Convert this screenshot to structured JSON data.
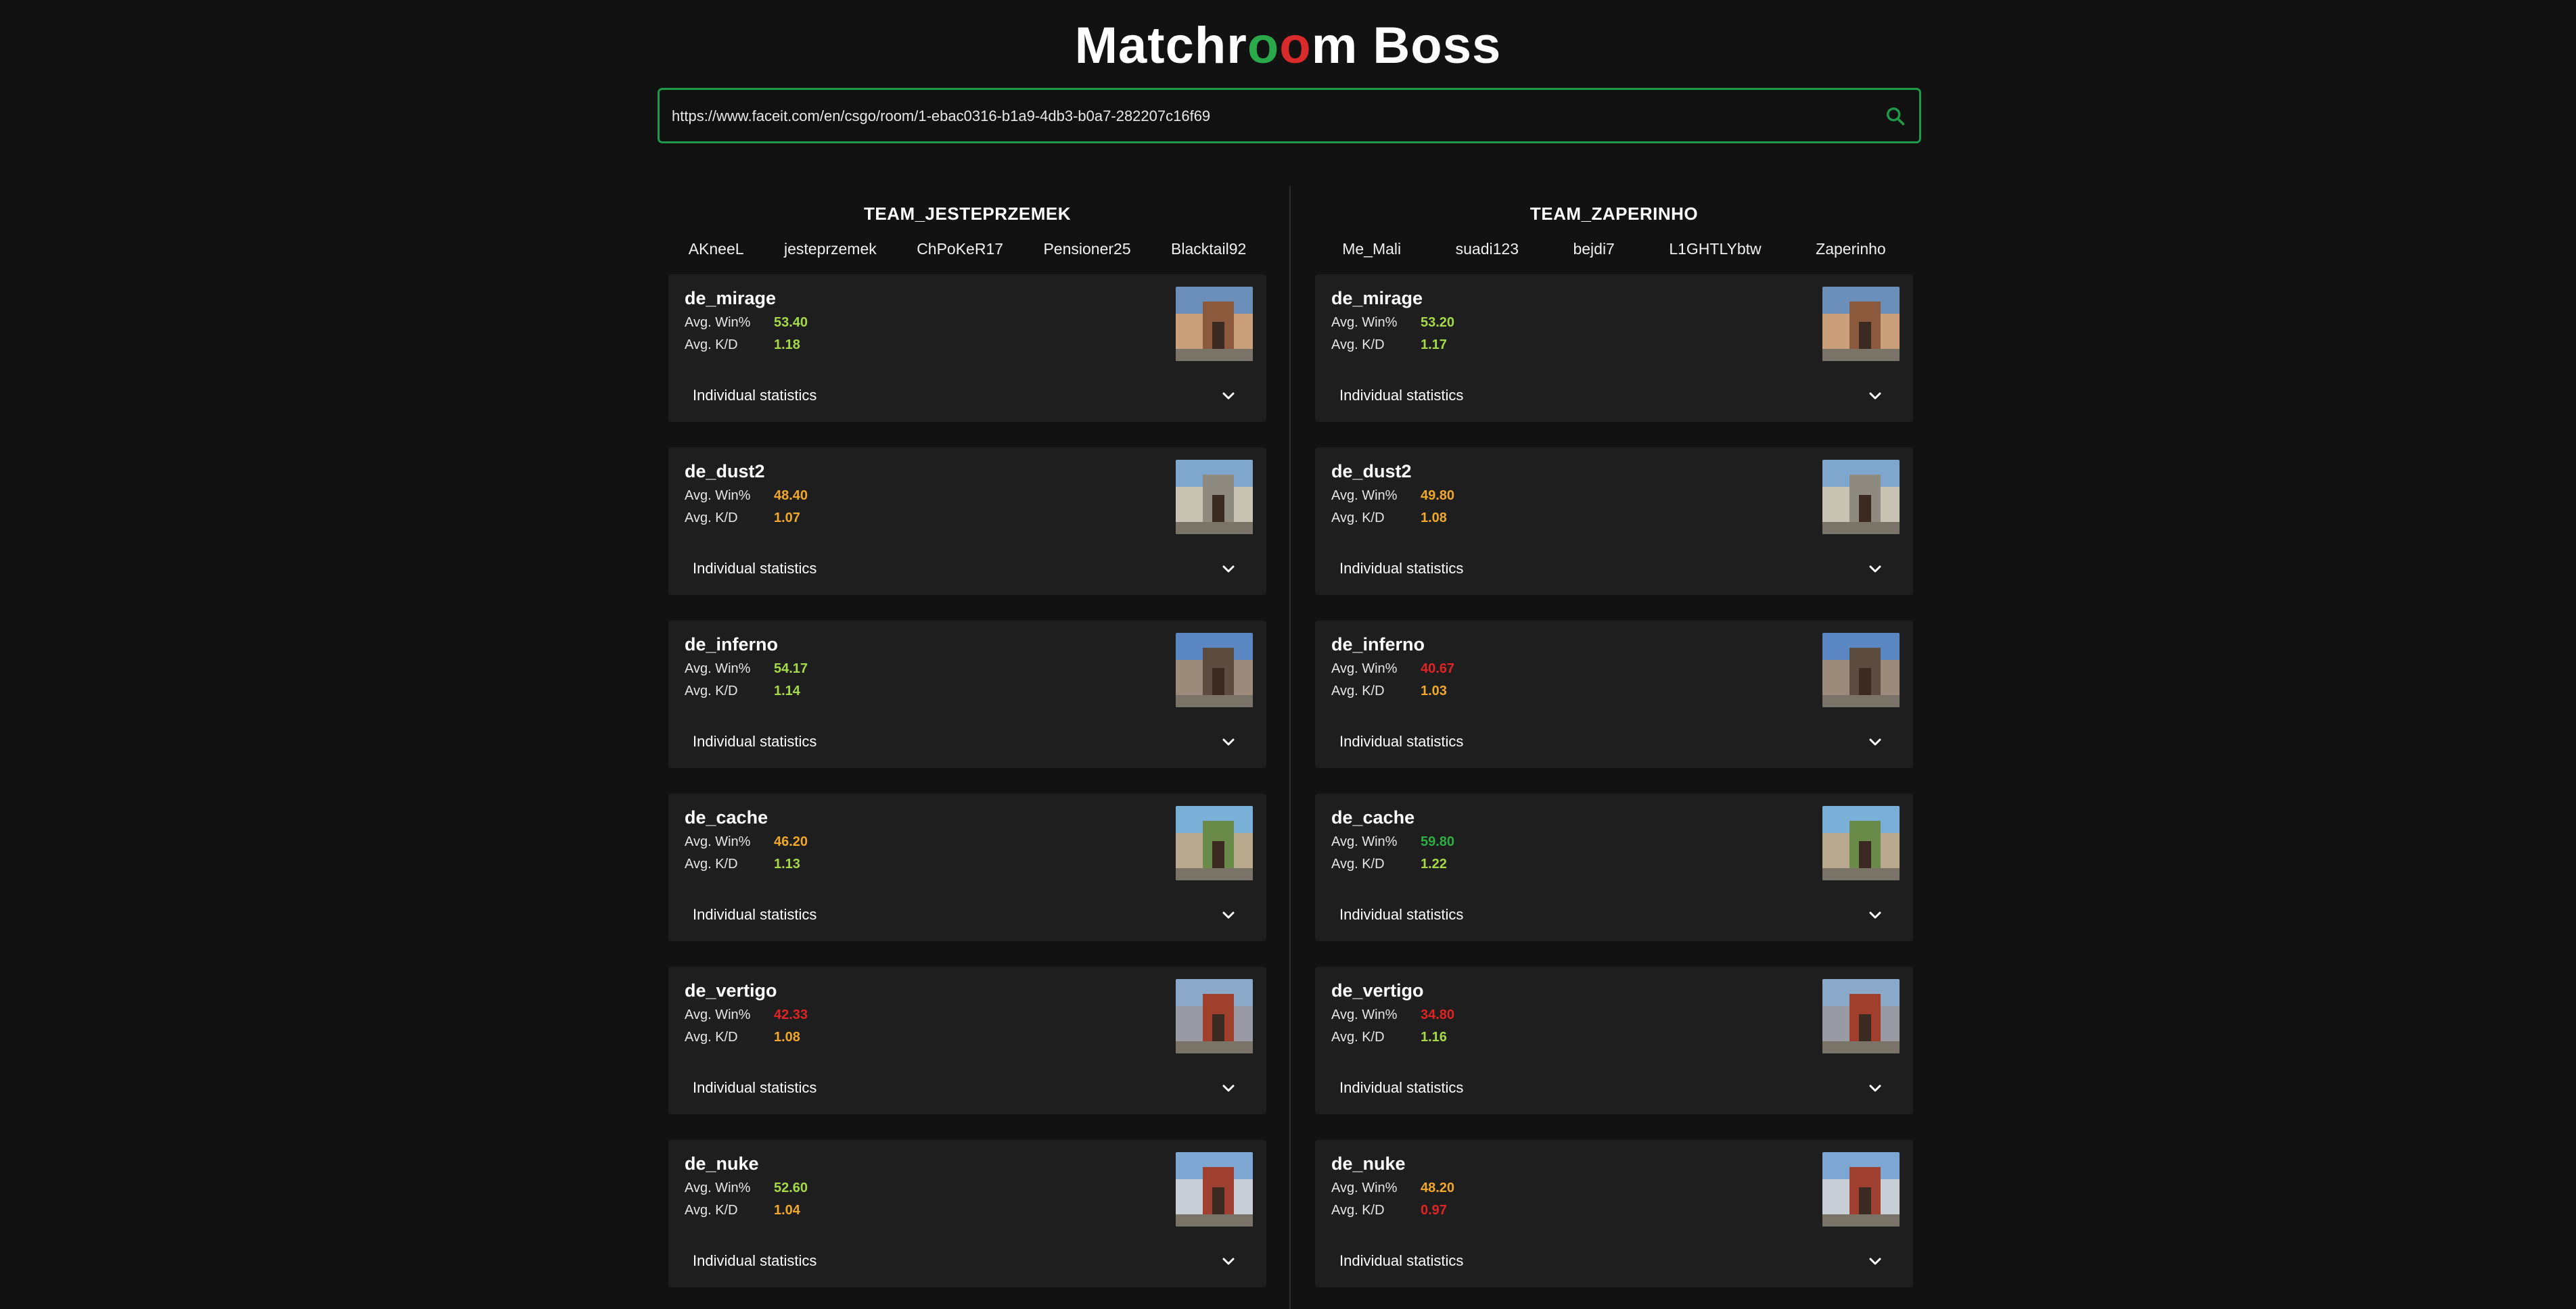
{
  "app": {
    "title_parts": [
      "Matchr",
      "o",
      "o",
      "m Boss"
    ]
  },
  "search": {
    "value": "https://www.faceit.com/en/csgo/room/1-ebac0316-b1a9-4db3-b0a7-282207c16f69",
    "icon": "search-icon"
  },
  "colors": {
    "accent_green": "#1e9a4a",
    "stat_good": "#a6d94a",
    "stat_mid": "#f0a72a",
    "stat_bad": "#e02424",
    "stat_great": "#2fae44"
  },
  "teams": [
    {
      "name": "TEAM_JESTEPRZEMEK",
      "players": [
        "AKneeL",
        "jesteprzemek",
        "ChPoKeR17",
        "Pensioner25",
        "Blacktail92"
      ],
      "maps": [
        {
          "name": "de_mirage",
          "win_label": "Avg. Win%",
          "win": "53.40",
          "win_color": "#a6d94a",
          "kd_label": "Avg. K/D",
          "kd": "1.18",
          "kd_color": "#a6d94a",
          "toggle": "Individual statistics"
        },
        {
          "name": "de_dust2",
          "win_label": "Avg. Win%",
          "win": "48.40",
          "win_color": "#f0a72a",
          "kd_label": "Avg. K/D",
          "kd": "1.07",
          "kd_color": "#f0a72a",
          "toggle": "Individual statistics"
        },
        {
          "name": "de_inferno",
          "win_label": "Avg. Win%",
          "win": "54.17",
          "win_color": "#a6d94a",
          "kd_label": "Avg. K/D",
          "kd": "1.14",
          "kd_color": "#a6d94a",
          "toggle": "Individual statistics"
        },
        {
          "name": "de_cache",
          "win_label": "Avg. Win%",
          "win": "46.20",
          "win_color": "#f0a72a",
          "kd_label": "Avg. K/D",
          "kd": "1.13",
          "kd_color": "#a6d94a",
          "toggle": "Individual statistics"
        },
        {
          "name": "de_vertigo",
          "win_label": "Avg. Win%",
          "win": "42.33",
          "win_color": "#e02424",
          "kd_label": "Avg. K/D",
          "kd": "1.08",
          "kd_color": "#f0a72a",
          "toggle": "Individual statistics"
        },
        {
          "name": "de_nuke",
          "win_label": "Avg. Win%",
          "win": "52.60",
          "win_color": "#a6d94a",
          "kd_label": "Avg. K/D",
          "kd": "1.04",
          "kd_color": "#f0a72a",
          "toggle": "Individual statistics"
        }
      ]
    },
    {
      "name": "TEAM_ZAPERINHO",
      "players": [
        "Me_Mali",
        "suadi123",
        "bejdi7",
        "L1GHTLYbtw",
        "Zaperinho"
      ],
      "maps": [
        {
          "name": "de_mirage",
          "win_label": "Avg. Win%",
          "win": "53.20",
          "win_color": "#a6d94a",
          "kd_label": "Avg. K/D",
          "kd": "1.17",
          "kd_color": "#a6d94a",
          "toggle": "Individual statistics"
        },
        {
          "name": "de_dust2",
          "win_label": "Avg. Win%",
          "win": "49.80",
          "win_color": "#f0a72a",
          "kd_label": "Avg. K/D",
          "kd": "1.08",
          "kd_color": "#f0a72a",
          "toggle": "Individual statistics"
        },
        {
          "name": "de_inferno",
          "win_label": "Avg. Win%",
          "win": "40.67",
          "win_color": "#e02424",
          "kd_label": "Avg. K/D",
          "kd": "1.03",
          "kd_color": "#f0a72a",
          "toggle": "Individual statistics"
        },
        {
          "name": "de_cache",
          "win_label": "Avg. Win%",
          "win": "59.80",
          "win_color": "#2fae44",
          "kd_label": "Avg. K/D",
          "kd": "1.22",
          "kd_color": "#a6d94a",
          "toggle": "Individual statistics"
        },
        {
          "name": "de_vertigo",
          "win_label": "Avg. Win%",
          "win": "34.80",
          "win_color": "#e02424",
          "kd_label": "Avg. K/D",
          "kd": "1.16",
          "kd_color": "#a6d94a",
          "toggle": "Individual statistics"
        },
        {
          "name": "de_nuke",
          "win_label": "Avg. Win%",
          "win": "48.20",
          "win_color": "#f0a72a",
          "kd_label": "Avg. K/D",
          "kd": "0.97",
          "kd_color": "#e02424",
          "toggle": "Individual statistics"
        }
      ]
    }
  ]
}
